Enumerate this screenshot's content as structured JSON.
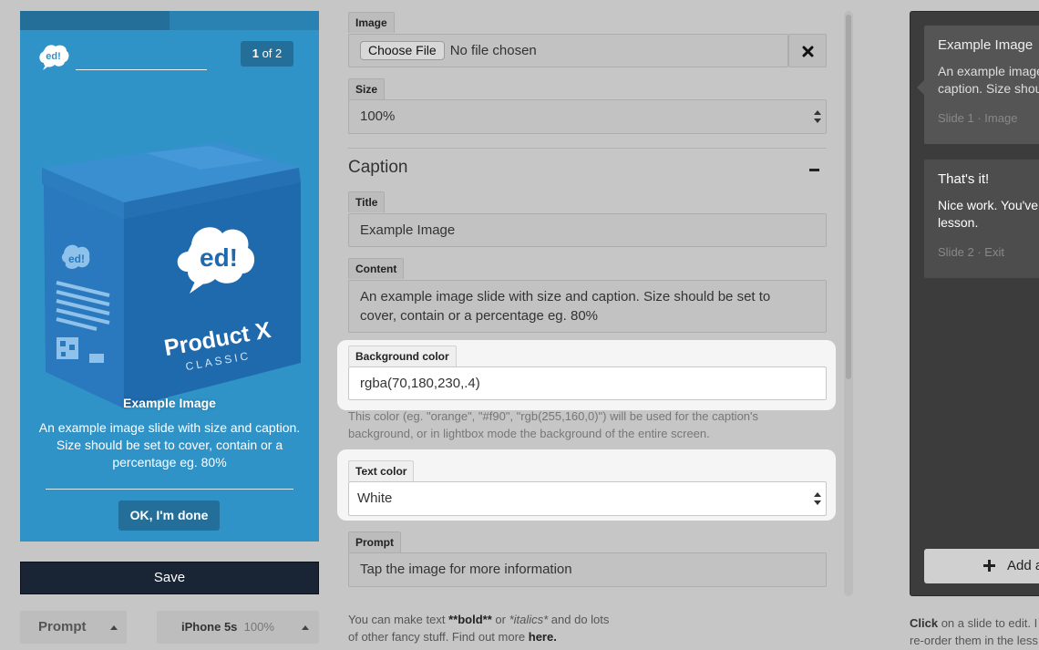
{
  "preview": {
    "progress": 0.5,
    "counter_current": "1",
    "counter_rest": "of 2",
    "slide_title": "Example Image",
    "slide_body": "An example image slide with size and caption. Size should be set to cover, contain or a percentage eg. 80%",
    "done_label": "OK, I'm done",
    "logo_text": "ed!",
    "box_brand": "ed!",
    "box_product": "Product X",
    "box_edition": "CLASSIC",
    "accent_color": "#2f93c8"
  },
  "save_label": "Save",
  "bottom_bar": {
    "prompt_label": "Prompt",
    "device_label": "iPhone 5s",
    "device_zoom": "100%"
  },
  "form": {
    "image": {
      "label": "Image",
      "choose_label": "Choose File",
      "file_status": "No file chosen"
    },
    "size": {
      "label": "Size",
      "value": "100%"
    },
    "caption_heading": "Caption",
    "title": {
      "label": "Title",
      "value": "Example Image"
    },
    "content": {
      "label": "Content",
      "value": "An example image slide with size and caption. Size should be set to cover, contain or a percentage eg. 80%"
    },
    "background_color": {
      "label": "Background color",
      "value": "rgba(70,180,230,.4)",
      "help": "This color (eg. \"orange\", \"#f90\", \"rgb(255,160,0)\") will be used for the caption's background, or in lightbox mode the background of the entire screen."
    },
    "text_color": {
      "label": "Text color",
      "value": "White"
    },
    "prompt": {
      "label": "Prompt",
      "value": "Tap the image for more information"
    },
    "markdown_help": {
      "pre": "You can make text ",
      "bold": "**bold**",
      "mid": " or ",
      "italic": "*italics*",
      "post": " and do lots of other fancy stuff. Find out more ",
      "link": "here."
    }
  },
  "slides": [
    {
      "title": "Example Image",
      "body_1": "An example image",
      "body_2": "caption. Size shou",
      "meta": "Slide 1 · Image"
    },
    {
      "title": "That's it!",
      "body_1": "Nice work. You've",
      "body_2": "lesson.",
      "meta": "Slide 2 · Exit"
    }
  ],
  "add_slide_label": "Add a",
  "right_help": {
    "click": "Click",
    "line1": " on a slide to edit. I",
    "line2": "re-order them in the less"
  }
}
